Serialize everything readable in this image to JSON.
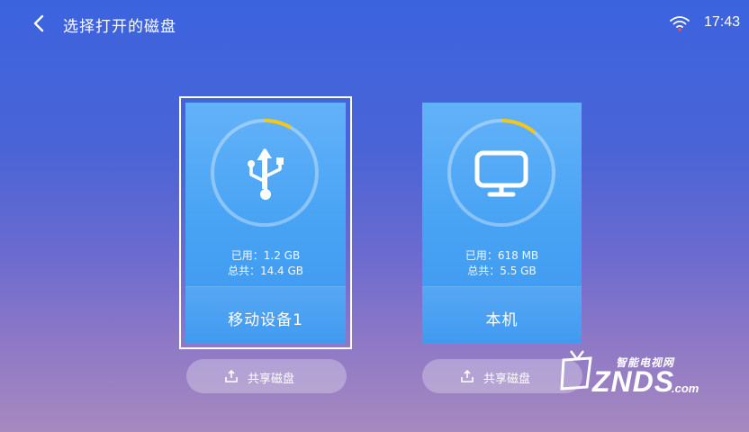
{
  "header": {
    "title": "选择打开的磁盘",
    "time": "17:43",
    "icons": {
      "back": "chevron-left-icon",
      "wifi": "wifi-icon"
    }
  },
  "disks": [
    {
      "name": "移动设备1",
      "used": "已用：1.2 GB",
      "total": "总共：14.4 GB",
      "usage_fraction": 0.083,
      "icon": "usb-icon",
      "focused": true,
      "share_label": "共享磁盘"
    },
    {
      "name": "本机",
      "used": "已用：618 MB",
      "total": "总共：5.5 GB",
      "usage_fraction": 0.11,
      "icon": "monitor-icon",
      "focused": false,
      "share_label": "共享磁盘"
    }
  ],
  "colors": {
    "accent_ring": "#f5c518",
    "card_top": "#63b2f8",
    "card_bottom": "#3d98f0",
    "background_top": "#3c63df",
    "background_bottom": "#a689c0"
  },
  "watermark": {
    "tag": "智能电视网",
    "main": "ZNDS",
    "suffix": ".com"
  }
}
